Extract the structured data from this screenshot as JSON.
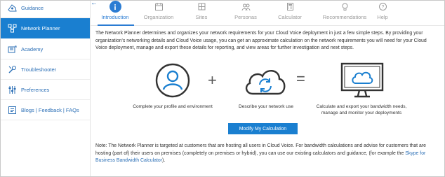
{
  "sidebar": {
    "items": [
      {
        "label": "Guidance",
        "icon": "guidance-icon",
        "active": false
      },
      {
        "label": "Network Planner",
        "icon": "network-planner-icon",
        "active": true
      },
      {
        "label": "Academy",
        "icon": "academy-icon",
        "active": false
      },
      {
        "label": "Troubleshooter",
        "icon": "troubleshooter-icon",
        "active": false
      },
      {
        "label": "Preferences",
        "icon": "preferences-icon",
        "active": false
      },
      {
        "label": "Blogs | Feedback | FAQs",
        "icon": "blogs-icon",
        "active": false
      }
    ]
  },
  "back": {
    "icon": "arrow-left-icon",
    "glyph": "←"
  },
  "tabs": [
    {
      "label": "Introduction",
      "icon": "info-icon",
      "active": true
    },
    {
      "label": "Organization",
      "icon": "calendar-icon",
      "active": false
    },
    {
      "label": "Sites",
      "icon": "sites-icon",
      "active": false
    },
    {
      "label": "Personas",
      "icon": "personas-icon",
      "active": false
    },
    {
      "label": "Calculator",
      "icon": "calculator-icon",
      "active": false
    },
    {
      "label": "Recommendations",
      "icon": "recommendations-icon",
      "active": false
    },
    {
      "label": "Help",
      "icon": "help-icon",
      "active": false
    }
  ],
  "intro_text": "The Network Planner determines and organizes your network requirements for your Cloud Voice deployment in just a few simple steps. By providing your organization's networking details and Cloud Voice usage, you can get an approximate calculation on the network requirements you will need for your Cloud Voice deployment, manage and export these details for reporting, and view areas for further investigation and next steps.",
  "steps": [
    {
      "caption": "Complete your profile and environment",
      "icon": "profile-icon"
    },
    {
      "operator": "+"
    },
    {
      "caption": "Describe your network use",
      "icon": "cloud-sync-icon"
    },
    {
      "operator": "="
    },
    {
      "caption": "Calculate and export your bandwidth needs, manage and monitor your deployments",
      "icon": "monitor-cloud-icon"
    }
  ],
  "button": {
    "label": "Modify My Calculation"
  },
  "note": {
    "text": "Note: The Network Planner is targeted at customers that are hosting all users in Cloud Voice.  For bandwidth calculations and advise for customers that are hosting (part of) their users on premises (completely on premises or hybrid), you can use our existing calculators and guidance, (for example the ",
    "link": "Skype for Business Bandwidth Calculator",
    "tail": ")."
  },
  "colors": {
    "accent": "#1a7fd0",
    "link": "#2b6fb6",
    "icon_dark": "#333333"
  }
}
